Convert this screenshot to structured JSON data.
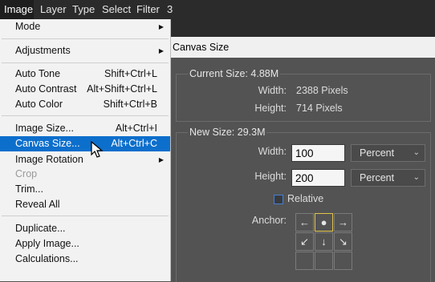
{
  "menubar": {
    "items": [
      {
        "label": "Image",
        "active": true
      },
      {
        "label": "Layer"
      },
      {
        "label": "Type"
      },
      {
        "label": "Select"
      },
      {
        "label": "Filter"
      },
      {
        "label": "3"
      }
    ]
  },
  "image_menu": {
    "items": [
      {
        "label": "Mode",
        "submenu": true
      },
      {
        "label": "Adjustments",
        "submenu": true
      },
      {
        "label": "Auto Tone",
        "shortcut": "Shift+Ctrl+L"
      },
      {
        "label": "Auto Contrast",
        "shortcut": "Alt+Shift+Ctrl+L"
      },
      {
        "label": "Auto Color",
        "shortcut": "Shift+Ctrl+B"
      },
      {
        "label": "Image Size...",
        "shortcut": "Alt+Ctrl+I"
      },
      {
        "label": "Canvas Size...",
        "shortcut": "Alt+Ctrl+C",
        "selected": true
      },
      {
        "label": "Image Rotation",
        "submenu": true
      },
      {
        "label": "Crop",
        "disabled": true
      },
      {
        "label": "Trim..."
      },
      {
        "label": "Reveal All"
      },
      {
        "label": "Duplicate..."
      },
      {
        "label": "Apply Image..."
      },
      {
        "label": "Calculations..."
      }
    ]
  },
  "dialog": {
    "title": "Canvas Size",
    "current_size": {
      "heading": "Current Size: 4.88M",
      "width_label": "Width:",
      "width_value": "2388 Pixels",
      "height_label": "Height:",
      "height_value": "714 Pixels"
    },
    "new_size": {
      "heading": "New Size: 29.3M",
      "width_label": "Width:",
      "width_value": "100",
      "width_unit": "Percent",
      "height_label": "Height:",
      "height_value": "200",
      "height_unit": "Percent",
      "relative_label": "Relative",
      "relative_checked": false,
      "anchor_label": "Anchor:"
    }
  }
}
